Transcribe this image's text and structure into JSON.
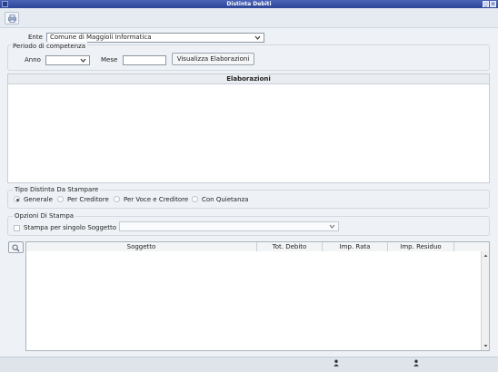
{
  "window": {
    "title": "Distinta Debiti"
  },
  "ente": {
    "label": "Ente",
    "value": "Comune di Maggioli Informatica"
  },
  "periodo": {
    "title": "Periodo di competenza",
    "anno_label": "Anno",
    "anno_value": "",
    "mese_label": "Mese",
    "mese_value": "",
    "button_label": "Visualizza Elaborazioni"
  },
  "elaborazioni": {
    "title": "Elaborazioni"
  },
  "tipo_distinta": {
    "title": "Tipo Distinta Da Stampare",
    "options": [
      "Generale",
      "Per Creditore",
      "Per Voce e Creditore",
      "Con Quietanza"
    ],
    "selected": "Generale"
  },
  "opzioni": {
    "title": "Opzioni Di Stampa",
    "checkbox_label": "Stampa per singolo Soggetto",
    "checked": false,
    "soggetto_value": ""
  },
  "grid": {
    "columns": [
      "Soggetto",
      "Tot. Debito",
      "Imp. Rata",
      "Imp. Residuo"
    ]
  }
}
